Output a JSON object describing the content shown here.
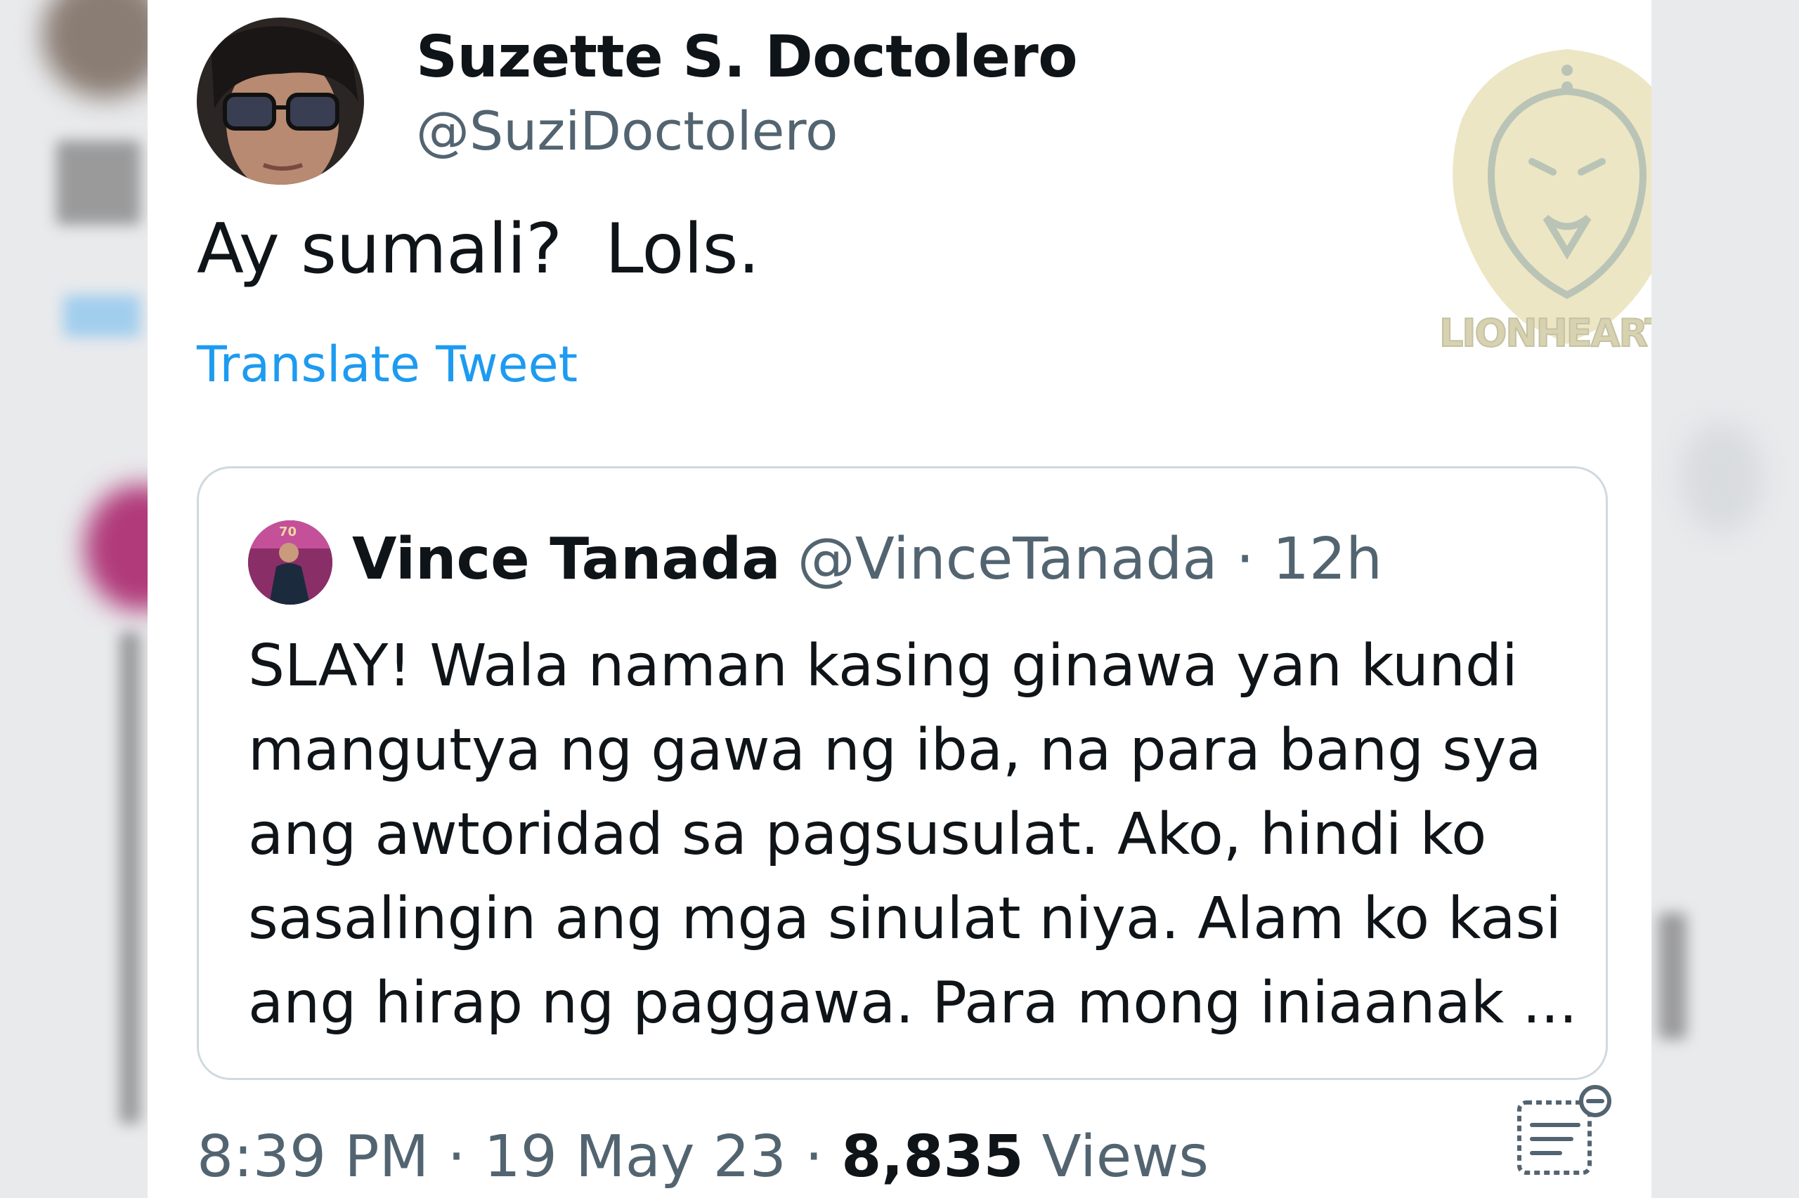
{
  "tweet": {
    "display_name": "Suzette S. Doctolero",
    "handle": "@SuziDoctolero",
    "text": "Ay sumali?  Lols.",
    "translate_label": "Translate Tweet",
    "time": "8:39 PM",
    "date": "19 May 23",
    "views_count": "8,835",
    "views_label": "Views",
    "separator": "·"
  },
  "quoted_tweet": {
    "display_name": "Vince Tanada",
    "handle": "@VinceTanada",
    "age": "12h",
    "text": "SLAY! Wala naman kasing ginawa yan kundi mangutya ng gawa ng iba, na para bang sya ang awtoridad sa pagsusulat. Ako, hindi ko sasalingin ang mga sinulat niya. Alam ko kasi ang hirap ng paggawa. Para mong iniaanak ..."
  },
  "watermark": {
    "text": "LIONHEARTV"
  },
  "icons": {
    "analytics": "analytics-icon",
    "lion_logo": "lion-logo-icon"
  },
  "colors": {
    "link": "#1d9bf0",
    "text_primary": "#0f1419",
    "text_secondary": "#536471",
    "border": "#cfd9de"
  }
}
